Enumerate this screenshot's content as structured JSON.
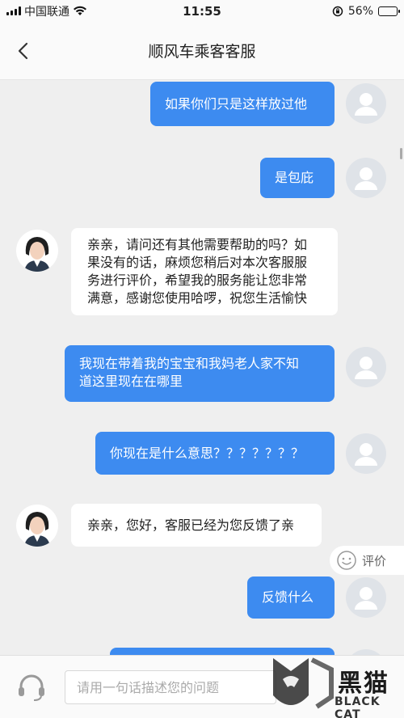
{
  "status": {
    "carrier": "中国联通",
    "time": "11:55",
    "battery": "56%",
    "battery_level": 0.56
  },
  "header": {
    "title": "顺风车乘客客服"
  },
  "messages": [
    {
      "from": "user",
      "text": "如果你们只是这样放过他"
    },
    {
      "from": "user",
      "text": "是包庇"
    },
    {
      "from": "agent",
      "lines": [
        "亲亲，请问还有其他需要帮助的吗？如",
        "果没有的话，麻烦您稍后对本次客服服",
        "务进行评价，希望我的服务能让您非常",
        "满意，感谢您使用哈啰，祝您生活愉快"
      ]
    },
    {
      "from": "user",
      "lines": [
        "我现在带着我的宝宝和我妈老人家不知",
        "道这里现在在哪里"
      ]
    },
    {
      "from": "user",
      "text": "你现在是什么意思？？？？？？？"
    },
    {
      "from": "agent",
      "text": "亲亲，您好，客服已经为您反馈了亲"
    },
    {
      "from": "user",
      "text": "反馈什么"
    }
  ],
  "rate_button": {
    "label": "评价"
  },
  "input": {
    "placeholder": "请用一句话描述您的问题"
  },
  "watermark": {
    "name": "黑猫",
    "sub": "BLACK CAT"
  }
}
